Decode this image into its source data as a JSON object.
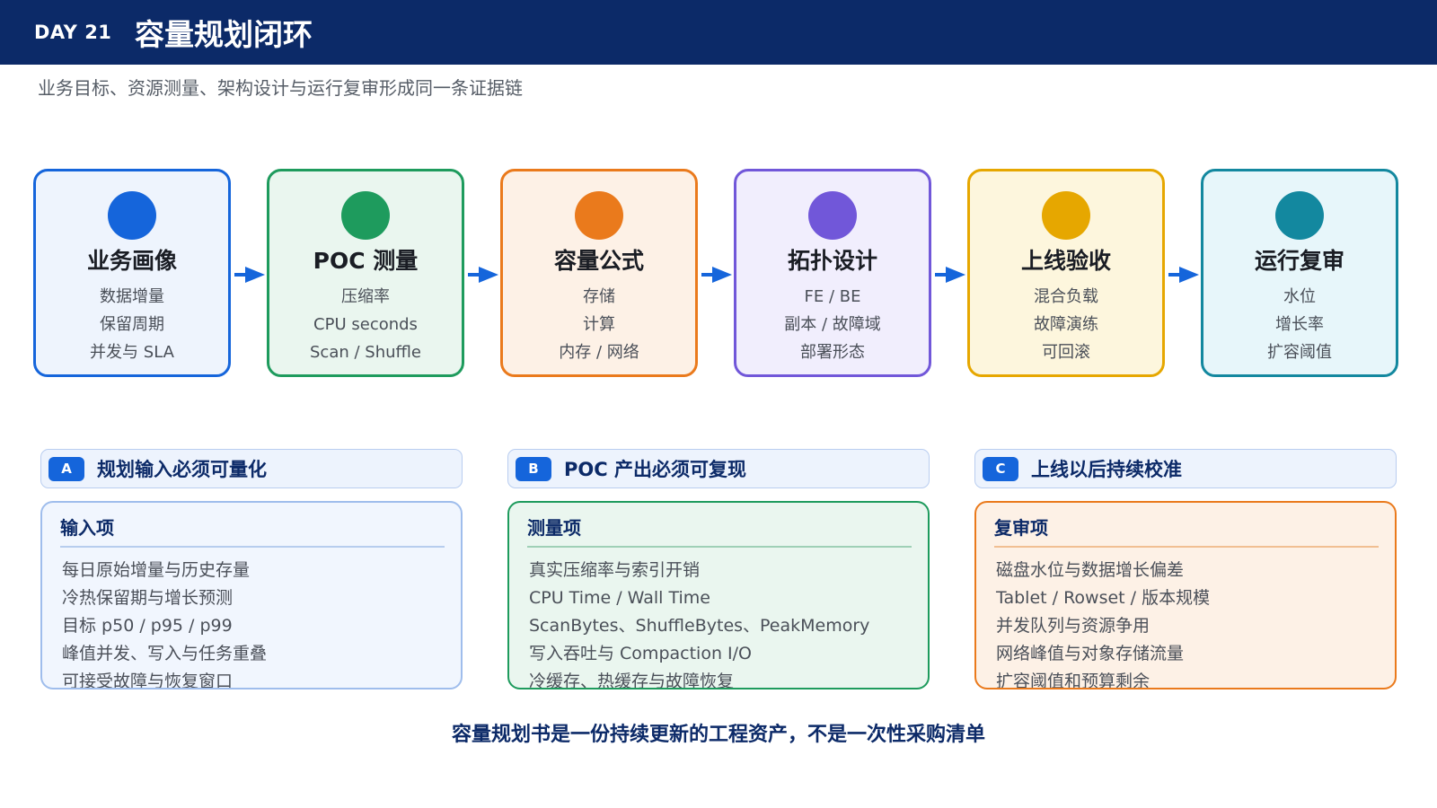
{
  "header": {
    "day": "DAY 21",
    "title": "容量规划闭环"
  },
  "subtitle": "业务目标、资源测量、架构设计与运行复审形成同一条证据链",
  "steps": [
    {
      "name": "业务画像",
      "items": [
        "数据增量",
        "保留周期",
        "并发与 SLA"
      ],
      "accent": "#1565db",
      "bg": "#eef4fd"
    },
    {
      "name": "POC 测量",
      "items": [
        "压缩率",
        "CPU seconds",
        "Scan / Shuffle"
      ],
      "accent": "#1e9b5d",
      "bg": "#eaf6ef"
    },
    {
      "name": "容量公式",
      "items": [
        "存储",
        "计算",
        "内存 / 网络"
      ],
      "accent": "#ea7a1c",
      "bg": "#fdf1e6"
    },
    {
      "name": "拓扑设计",
      "items": [
        "FE / BE",
        "副本 / 故障域",
        "部署形态"
      ],
      "accent": "#7157d9",
      "bg": "#f1eefd"
    },
    {
      "name": "上线验收",
      "items": [
        "混合负载",
        "故障演练",
        "可回滚"
      ],
      "accent": "#e6a700",
      "bg": "#fdf6dd"
    },
    {
      "name": "运行复审",
      "items": [
        "水位",
        "增长率",
        "扩容阈值"
      ],
      "accent": "#13889f",
      "bg": "#e7f6fa"
    }
  ],
  "arrow_color": "#1565db",
  "sections": [
    {
      "badge": "A",
      "label": "规划输入必须可量化",
      "box_title": "输入项",
      "items": [
        "每日原始增量与历史存量",
        "冷热保留期与增长预测",
        "目标 p50 / p95 / p99",
        "峰值并发、写入与任务重叠",
        "可接受故障与恢复窗口"
      ],
      "border": "#9fbdec",
      "bg": "#f1f6fe",
      "rule": "#b7cdee"
    },
    {
      "badge": "B",
      "label": "POC 产出必须可复现",
      "box_title": "测量项",
      "items": [
        "真实压缩率与索引开销",
        "CPU Time / Wall Time",
        "ScanBytes、ShuffleBytes、PeakMemory",
        "写入吞吐与 Compaction I/O",
        "冷缓存、热缓存与故障恢复"
      ],
      "border": "#1e9b5d",
      "bg": "#eaf6ef",
      "rule": "#9fd0b6"
    },
    {
      "badge": "C",
      "label": "上线以后持续校准",
      "box_title": "复审项",
      "items": [
        "磁盘水位与数据增长偏差",
        "Tablet / Rowset / 版本规模",
        "并发队列与资源争用",
        "网络峰值与对象存储流量",
        "扩容阈值和预算剩余"
      ],
      "border": "#ea7a1c",
      "bg": "#fdf1e6",
      "rule": "#f1bf92"
    }
  ],
  "footer": "容量规划书是一份持续更新的工程资产，不是一次性采购清单"
}
